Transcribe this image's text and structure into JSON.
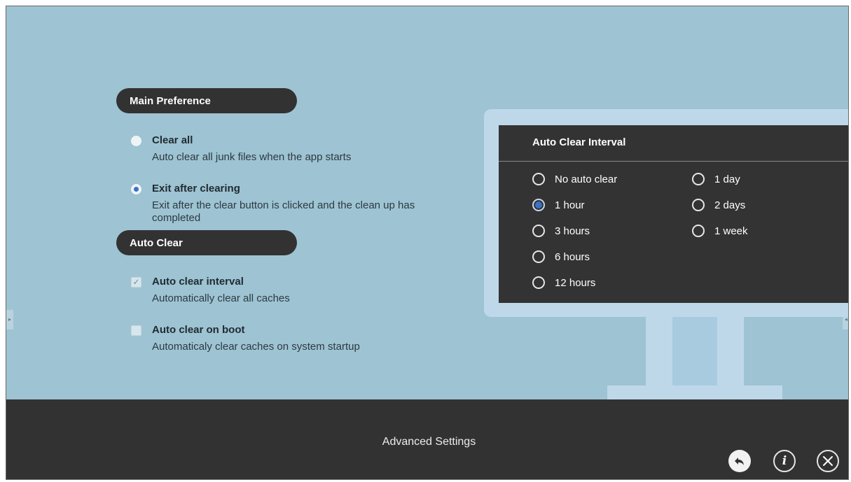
{
  "main_preference": {
    "header": "Main Preference",
    "options": [
      {
        "title": "Clear all",
        "description": "Auto clear all junk files when the app starts",
        "selected": false
      },
      {
        "title": "Exit after clearing",
        "description": "Exit after the clear button is clicked and the clean up has completed",
        "selected": true
      }
    ]
  },
  "auto_clear": {
    "header": "Auto Clear",
    "options": [
      {
        "title": "Auto clear interval",
        "description": "Automatically clear all caches",
        "checked": true
      },
      {
        "title": "Auto clear on boot",
        "description": "Automaticaly clear caches on system startup",
        "checked": false
      }
    ]
  },
  "interval_dialog": {
    "title": "Auto Clear Interval",
    "options": [
      {
        "label": "No auto clear",
        "selected": false
      },
      {
        "label": "1 hour",
        "selected": true
      },
      {
        "label": "3 hours",
        "selected": false
      },
      {
        "label": "6 hours",
        "selected": false
      },
      {
        "label": "12 hours",
        "selected": false
      },
      {
        "label": "1 day",
        "selected": false
      },
      {
        "label": "2 days",
        "selected": false
      },
      {
        "label": "1 week",
        "selected": false
      }
    ]
  },
  "footer": {
    "title": "Advanced Settings",
    "buttons": {
      "back": "back-icon",
      "info": "info-icon",
      "close": "close-icon"
    }
  },
  "colors": {
    "background": "#9ec3d3",
    "panel": "#323232",
    "accent": "#3a72c7"
  }
}
